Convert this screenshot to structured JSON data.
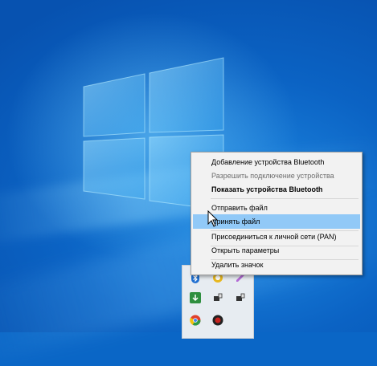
{
  "context_menu": {
    "items": [
      {
        "label": "Добавление устройства Bluetooth",
        "state": "normal"
      },
      {
        "label": "Разрешить подключение устройства",
        "state": "disabled"
      },
      {
        "label": "Показать устройства Bluetooth",
        "state": "bold"
      },
      {
        "label": "Отправить файл",
        "state": "normal"
      },
      {
        "label": "Принять файл",
        "state": "hover"
      },
      {
        "label": "Присоединиться к личной сети (PAN)",
        "state": "normal"
      },
      {
        "label": "Открыть параметры",
        "state": "normal"
      },
      {
        "label": "Удалить значок",
        "state": "normal"
      }
    ]
  },
  "tray_icons": [
    {
      "icon": "bluetooth-icon",
      "color": "#1f6fd1"
    },
    {
      "icon": "app-icon-yellow",
      "color": "#e8b81f"
    },
    {
      "icon": "pen-icon",
      "color": "#b46bd6"
    },
    {
      "icon": "download-icon",
      "color": "#2f8f3f"
    },
    {
      "icon": "usb-eject-icon",
      "color": "#333333"
    },
    {
      "icon": "usb-eject-icon",
      "color": "#333333"
    },
    {
      "icon": "chrome-icon",
      "color": "#e0402c"
    },
    {
      "icon": "app-icon-red",
      "color": "#c8231f"
    }
  ],
  "colors": {
    "desktop": "#0a66c6",
    "menu_bg": "#f2f2f2",
    "menu_hover": "#91c9f7",
    "menu_disabled_text": "#6d6d6d"
  }
}
